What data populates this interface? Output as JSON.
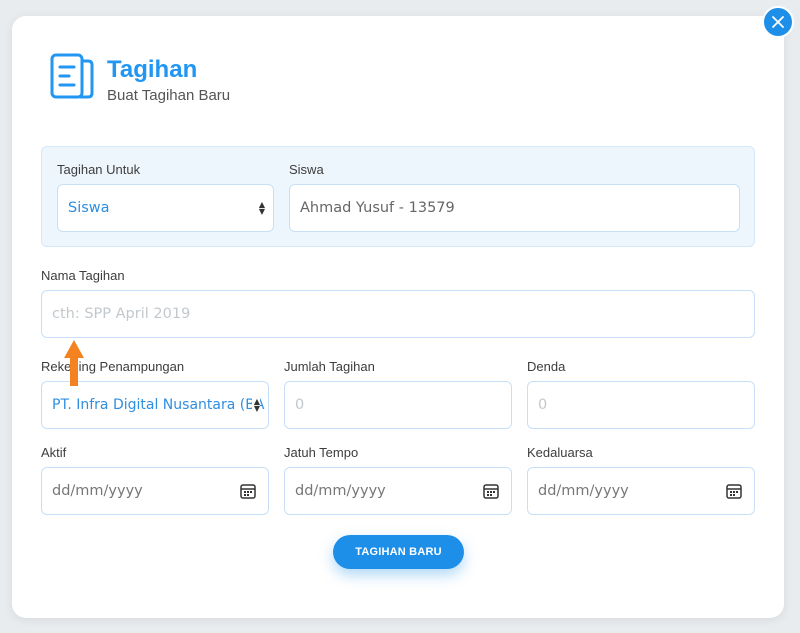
{
  "header": {
    "title": "Tagihan",
    "subtitle": "Buat Tagihan Baru"
  },
  "form": {
    "tagihan_untuk": {
      "label": "Tagihan Untuk",
      "value": "Siswa"
    },
    "siswa": {
      "label": "Siswa",
      "value": "Ahmad Yusuf - 13579"
    },
    "nama_tagihan": {
      "label": "Nama Tagihan",
      "placeholder": "cth: SPP April 2019"
    },
    "rekening": {
      "label": "Rekening Penampungan",
      "value": "PT. Infra Digital Nusantara (BA"
    },
    "jumlah_tagihan": {
      "label": "Jumlah Tagihan",
      "placeholder": "0"
    },
    "denda": {
      "label": "Denda",
      "placeholder": "0"
    },
    "aktif": {
      "label": "Aktif",
      "placeholder": "dd/mm/yyyy"
    },
    "jatuh_tempo": {
      "label": "Jatuh Tempo",
      "placeholder": "dd/mm/yyyy"
    },
    "kedaluarsa": {
      "label": "Kedaluarsa",
      "placeholder": "dd/mm/yyyy"
    }
  },
  "actions": {
    "submit_label": "TAGIHAN BARU"
  },
  "icons": {
    "header": "document-icon",
    "close": "close-icon",
    "calendar": "calendar-icon",
    "select": "select-arrows-icon",
    "annotation": "arrow-up-icon"
  },
  "colors": {
    "accent": "#1e8fe8",
    "title": "#2196f3",
    "panel_bg": "#eef6fd",
    "annotation": "#f58220"
  }
}
